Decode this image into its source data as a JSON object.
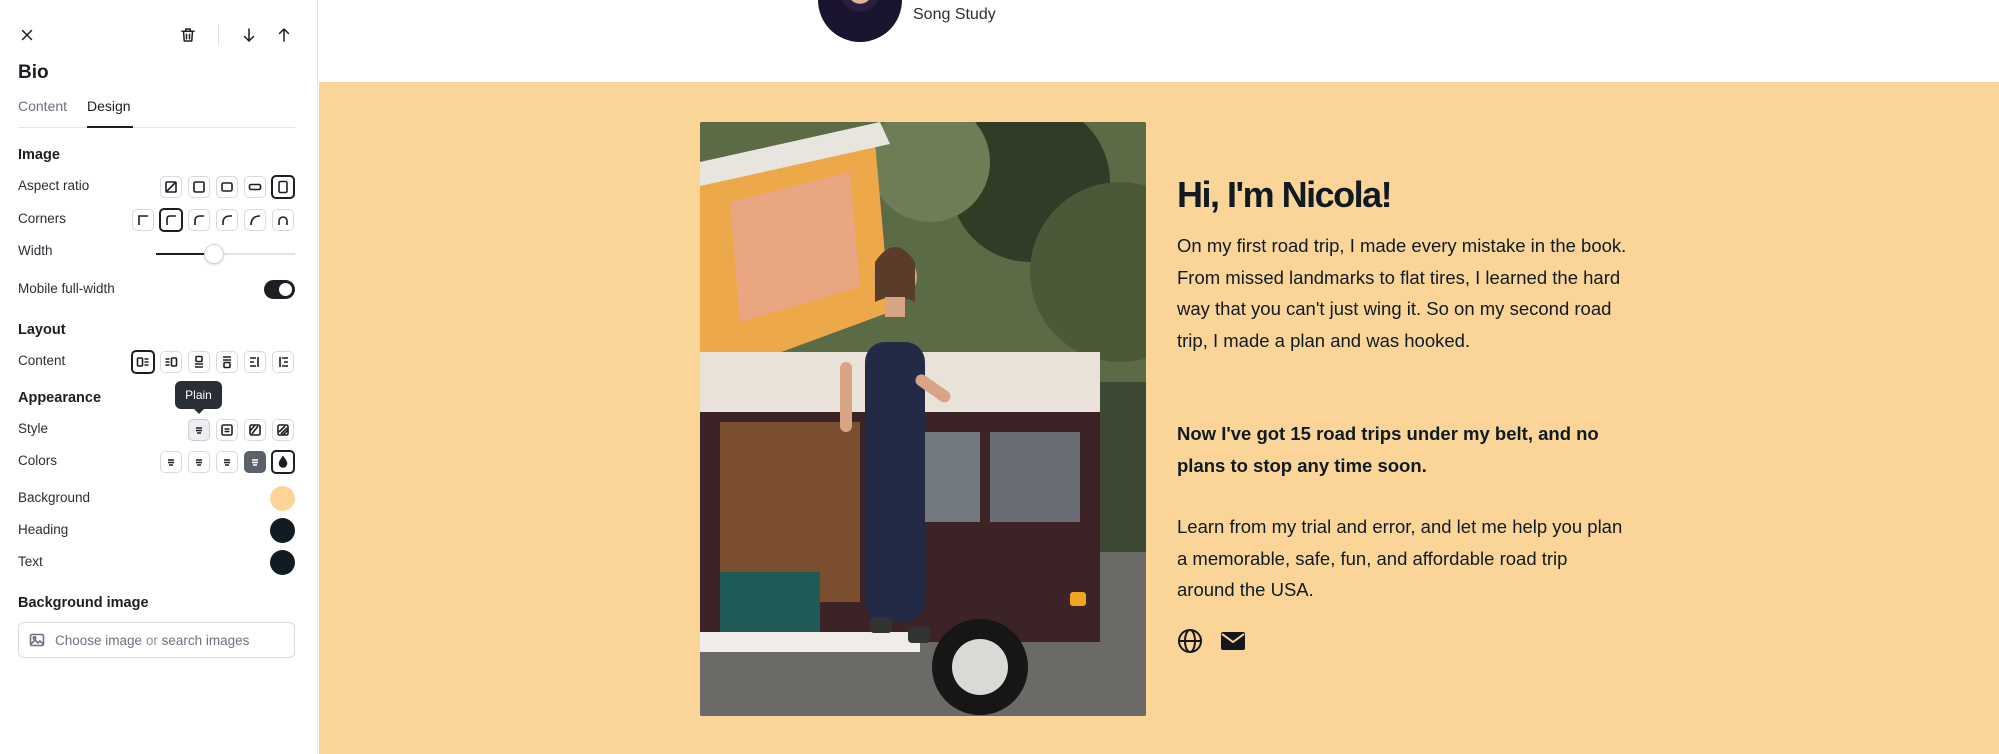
{
  "panel": {
    "title": "Bio",
    "tabs": [
      {
        "label": "Content",
        "active": false
      },
      {
        "label": "Design",
        "active": true
      }
    ],
    "sections": {
      "image": "Image",
      "layout": "Layout",
      "appearance": "Appearance",
      "background_image": "Background image"
    },
    "rows": {
      "aspect_ratio": "Aspect ratio",
      "corners": "Corners",
      "width": "Width",
      "mobile_full_width": "Mobile full-width",
      "content": "Content",
      "style": "Style",
      "colors": "Colors",
      "background": "Background",
      "heading": "Heading",
      "text": "Text"
    },
    "width_value": 0.42,
    "mobile_full_width_on": true,
    "tooltip": "Plain",
    "colors": {
      "background": "#fbd597",
      "heading": "#0f1a22",
      "text": "#0f1a22"
    },
    "image_input": {
      "part1": "Choose image",
      "or": "or",
      "part2": "search images"
    }
  },
  "site": {
    "brand": "Song Study",
    "bio_bg": "#fbd597",
    "heading": "Hi, I'm Nicola!",
    "paragraphs": [
      "On my first road trip, I made every mistake in the book. From missed landmarks to flat tires, I learned the hard way that you can't just wing it. So on my second road trip, I made a plan and was hooked.",
      "Now I've got 15 road trips under my belt, and no plans to stop any time soon.",
      "Learn from my trial and error, and let me help you plan a memorable, safe, fun, and affordable road trip around the USA."
    ],
    "social_icons": [
      "globe-icon",
      "mail-icon"
    ]
  }
}
